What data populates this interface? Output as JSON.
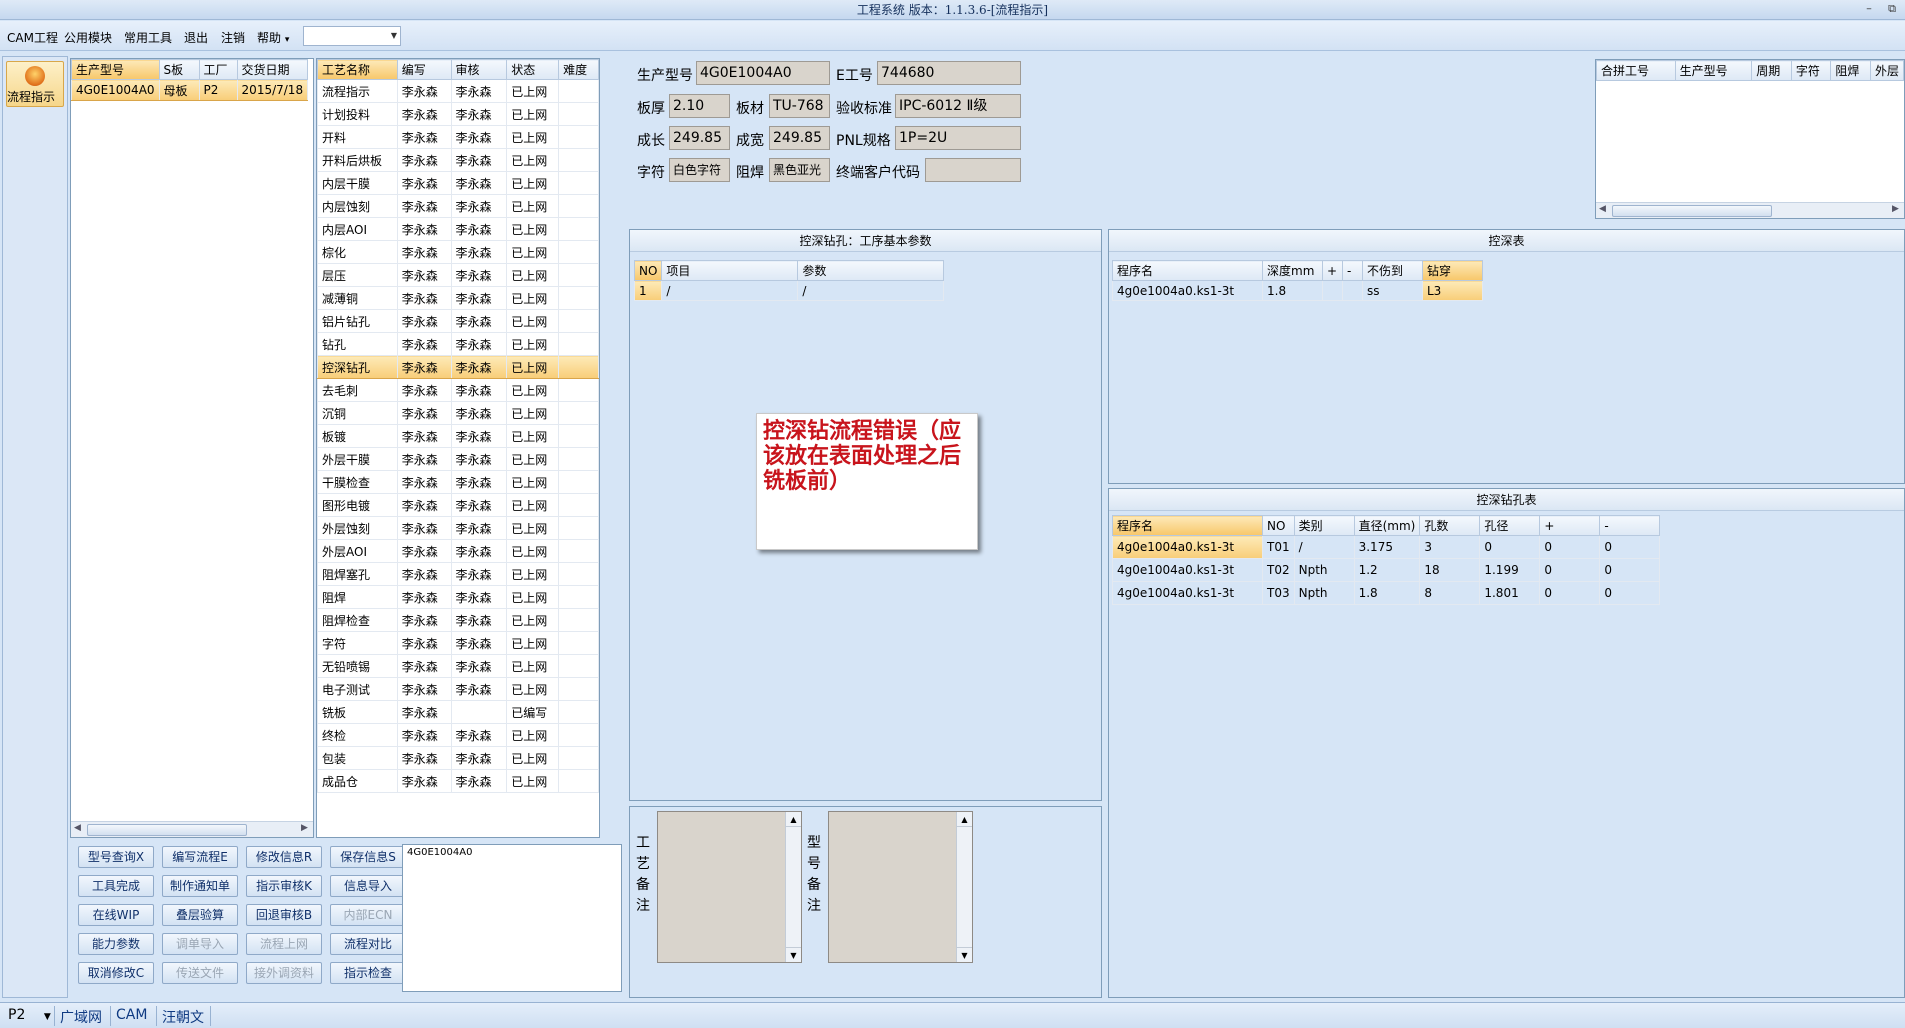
{
  "window": {
    "title": "工程系统 版本：1.1.3.6-[流程指示]",
    "min": "–",
    "restore": "⧉"
  },
  "menu": {
    "items": [
      "CAM工程",
      "公用模块",
      "常用工具",
      "退出",
      "注销",
      "帮助"
    ],
    "help_arrow": "▾",
    "combo_value": ""
  },
  "nav": {
    "button_label": "流程指示"
  },
  "orders": {
    "columns": [
      "生产型号",
      "S板",
      "工厂",
      "交货日期"
    ],
    "rows": [
      [
        "4G0E1004A0",
        "母板",
        "P2",
        "2015/7/18"
      ]
    ]
  },
  "process": {
    "columns": [
      "工艺名称",
      "编写",
      "审核",
      "状态",
      "难度"
    ],
    "selected_index": 12,
    "rows": [
      [
        "流程指示",
        "李永森",
        "李永森",
        "已上网",
        ""
      ],
      [
        "计划投料",
        "李永森",
        "李永森",
        "已上网",
        ""
      ],
      [
        "开料",
        "李永森",
        "李永森",
        "已上网",
        ""
      ],
      [
        "开料后烘板",
        "李永森",
        "李永森",
        "已上网",
        ""
      ],
      [
        "内层干膜",
        "李永森",
        "李永森",
        "已上网",
        ""
      ],
      [
        "内层蚀刻",
        "李永森",
        "李永森",
        "已上网",
        ""
      ],
      [
        "内层AOI",
        "李永森",
        "李永森",
        "已上网",
        ""
      ],
      [
        "棕化",
        "李永森",
        "李永森",
        "已上网",
        ""
      ],
      [
        "层压",
        "李永森",
        "李永森",
        "已上网",
        ""
      ],
      [
        "减薄铜",
        "李永森",
        "李永森",
        "已上网",
        ""
      ],
      [
        "铝片钻孔",
        "李永森",
        "李永森",
        "已上网",
        ""
      ],
      [
        "钻孔",
        "李永森",
        "李永森",
        "已上网",
        ""
      ],
      [
        "控深钻孔",
        "李永森",
        "李永森",
        "已上网",
        ""
      ],
      [
        "去毛刺",
        "李永森",
        "李永森",
        "已上网",
        ""
      ],
      [
        "沉铜",
        "李永森",
        "李永森",
        "已上网",
        ""
      ],
      [
        "板镀",
        "李永森",
        "李永森",
        "已上网",
        ""
      ],
      [
        "外层干膜",
        "李永森",
        "李永森",
        "已上网",
        ""
      ],
      [
        "干膜检查",
        "李永森",
        "李永森",
        "已上网",
        ""
      ],
      [
        "图形电镀",
        "李永森",
        "李永森",
        "已上网",
        ""
      ],
      [
        "外层蚀刻",
        "李永森",
        "李永森",
        "已上网",
        ""
      ],
      [
        "外层AOI",
        "李永森",
        "李永森",
        "已上网",
        ""
      ],
      [
        "阻焊塞孔",
        "李永森",
        "李永森",
        "已上网",
        ""
      ],
      [
        "阻焊",
        "李永森",
        "李永森",
        "已上网",
        ""
      ],
      [
        "阻焊检查",
        "李永森",
        "李永森",
        "已上网",
        ""
      ],
      [
        "字符",
        "李永森",
        "李永森",
        "已上网",
        ""
      ],
      [
        "无铅喷锡",
        "李永森",
        "李永森",
        "已上网",
        ""
      ],
      [
        "电子测试",
        "李永森",
        "李永森",
        "已上网",
        ""
      ],
      [
        "铣板",
        "李永森",
        "",
        "已编写",
        ""
      ],
      [
        "终检",
        "李永森",
        "李永森",
        "已上网",
        ""
      ],
      [
        "包装",
        "李永森",
        "李永森",
        "已上网",
        ""
      ],
      [
        "成品仓",
        "李永森",
        "李永森",
        "已上网",
        ""
      ]
    ]
  },
  "buttons": [
    {
      "label": "型号查询X",
      "enabled": true
    },
    {
      "label": "编写流程E",
      "enabled": true
    },
    {
      "label": "修改信息R",
      "enabled": true
    },
    {
      "label": "保存信息S",
      "enabled": true
    },
    {
      "label": "工具完成",
      "enabled": true
    },
    {
      "label": "制作通知单",
      "enabled": true
    },
    {
      "label": "指示审核K",
      "enabled": true
    },
    {
      "label": "信息导入",
      "enabled": true
    },
    {
      "label": "在线WIP",
      "enabled": true
    },
    {
      "label": "叠层验算",
      "enabled": true
    },
    {
      "label": "回退审核B",
      "enabled": true
    },
    {
      "label": "内部ECN",
      "enabled": false
    },
    {
      "label": "能力参数",
      "enabled": true
    },
    {
      "label": "调单导入",
      "enabled": false
    },
    {
      "label": "流程上网",
      "enabled": false
    },
    {
      "label": "流程对比",
      "enabled": true
    },
    {
      "label": "取消修改C",
      "enabled": true
    },
    {
      "label": "传送文件",
      "enabled": false
    },
    {
      "label": "接外调资料",
      "enabled": false
    },
    {
      "label": "指示检查",
      "enabled": true
    }
  ],
  "note_text": "4G0E1004A0",
  "info": {
    "prod_model_label": "生产型号",
    "prod_model": "4G0E1004A0",
    "e_no_label": "E工号",
    "e_no": "744680",
    "thickness_label": "板厚",
    "thickness": "2.10",
    "material_label": "板材",
    "material": "TU-768",
    "standard_label": "验收标准",
    "standard": "IPC-6012 Ⅱ级",
    "length_label": "成长",
    "length": "249.85",
    "width_label": "成宽",
    "width": "249.85",
    "pnl_label": "PNL规格",
    "pnl": "1P=2U",
    "char_label": "字符",
    "char": "白色字符",
    "mask_label": "阻焊",
    "mask": "黑色亚光",
    "client_label": "终端客户代码",
    "client": ""
  },
  "merge": {
    "columns": [
      "合拼工号",
      "生产型号",
      "周期",
      "字符",
      "阻焊",
      "外层"
    ]
  },
  "params": {
    "title": "控深钻孔：工序基本参数",
    "columns": [
      "NO",
      "项目",
      "参数"
    ],
    "rows": [
      [
        "1",
        "/",
        "/"
      ]
    ]
  },
  "depth_table": {
    "title": "控深表",
    "columns": [
      "程序名",
      "深度mm",
      "+",
      "-",
      "不伤到",
      "钻穿"
    ],
    "rows": [
      [
        "4g0e1004a0.ks1-3t",
        "1.8",
        "",
        "",
        "ss",
        "L3"
      ]
    ]
  },
  "hole_table": {
    "title": "控深钻孔表",
    "columns": [
      "程序名",
      "NO",
      "类别",
      "直径(mm)",
      "孔数",
      "孔径",
      "+",
      "-"
    ],
    "rows": [
      [
        "4g0e1004a0.ks1-3t",
        "T01",
        "/",
        "3.175",
        "3",
        "0",
        "0",
        "0"
      ],
      [
        "4g0e1004a0.ks1-3t",
        "T02",
        "Npth",
        "1.2",
        "18",
        "1.199",
        "0",
        "0"
      ],
      [
        "4g0e1004a0.ks1-3t",
        "T03",
        "Npth",
        "1.8",
        "8",
        "1.801",
        "0",
        "0"
      ]
    ]
  },
  "memo": {
    "process_label": "工艺备注",
    "model_label": "型号备注"
  },
  "annotation": {
    "text": "控深钻流程错误（应该放在表面处理之后铣板前）"
  },
  "status": {
    "combo": "P2",
    "items": [
      "广域网",
      "CAM",
      "汪朝文"
    ]
  },
  "colors": {
    "accent": "#f7c76a",
    "annotation": "#c8141c",
    "field_bg": "#d9d4cc"
  }
}
